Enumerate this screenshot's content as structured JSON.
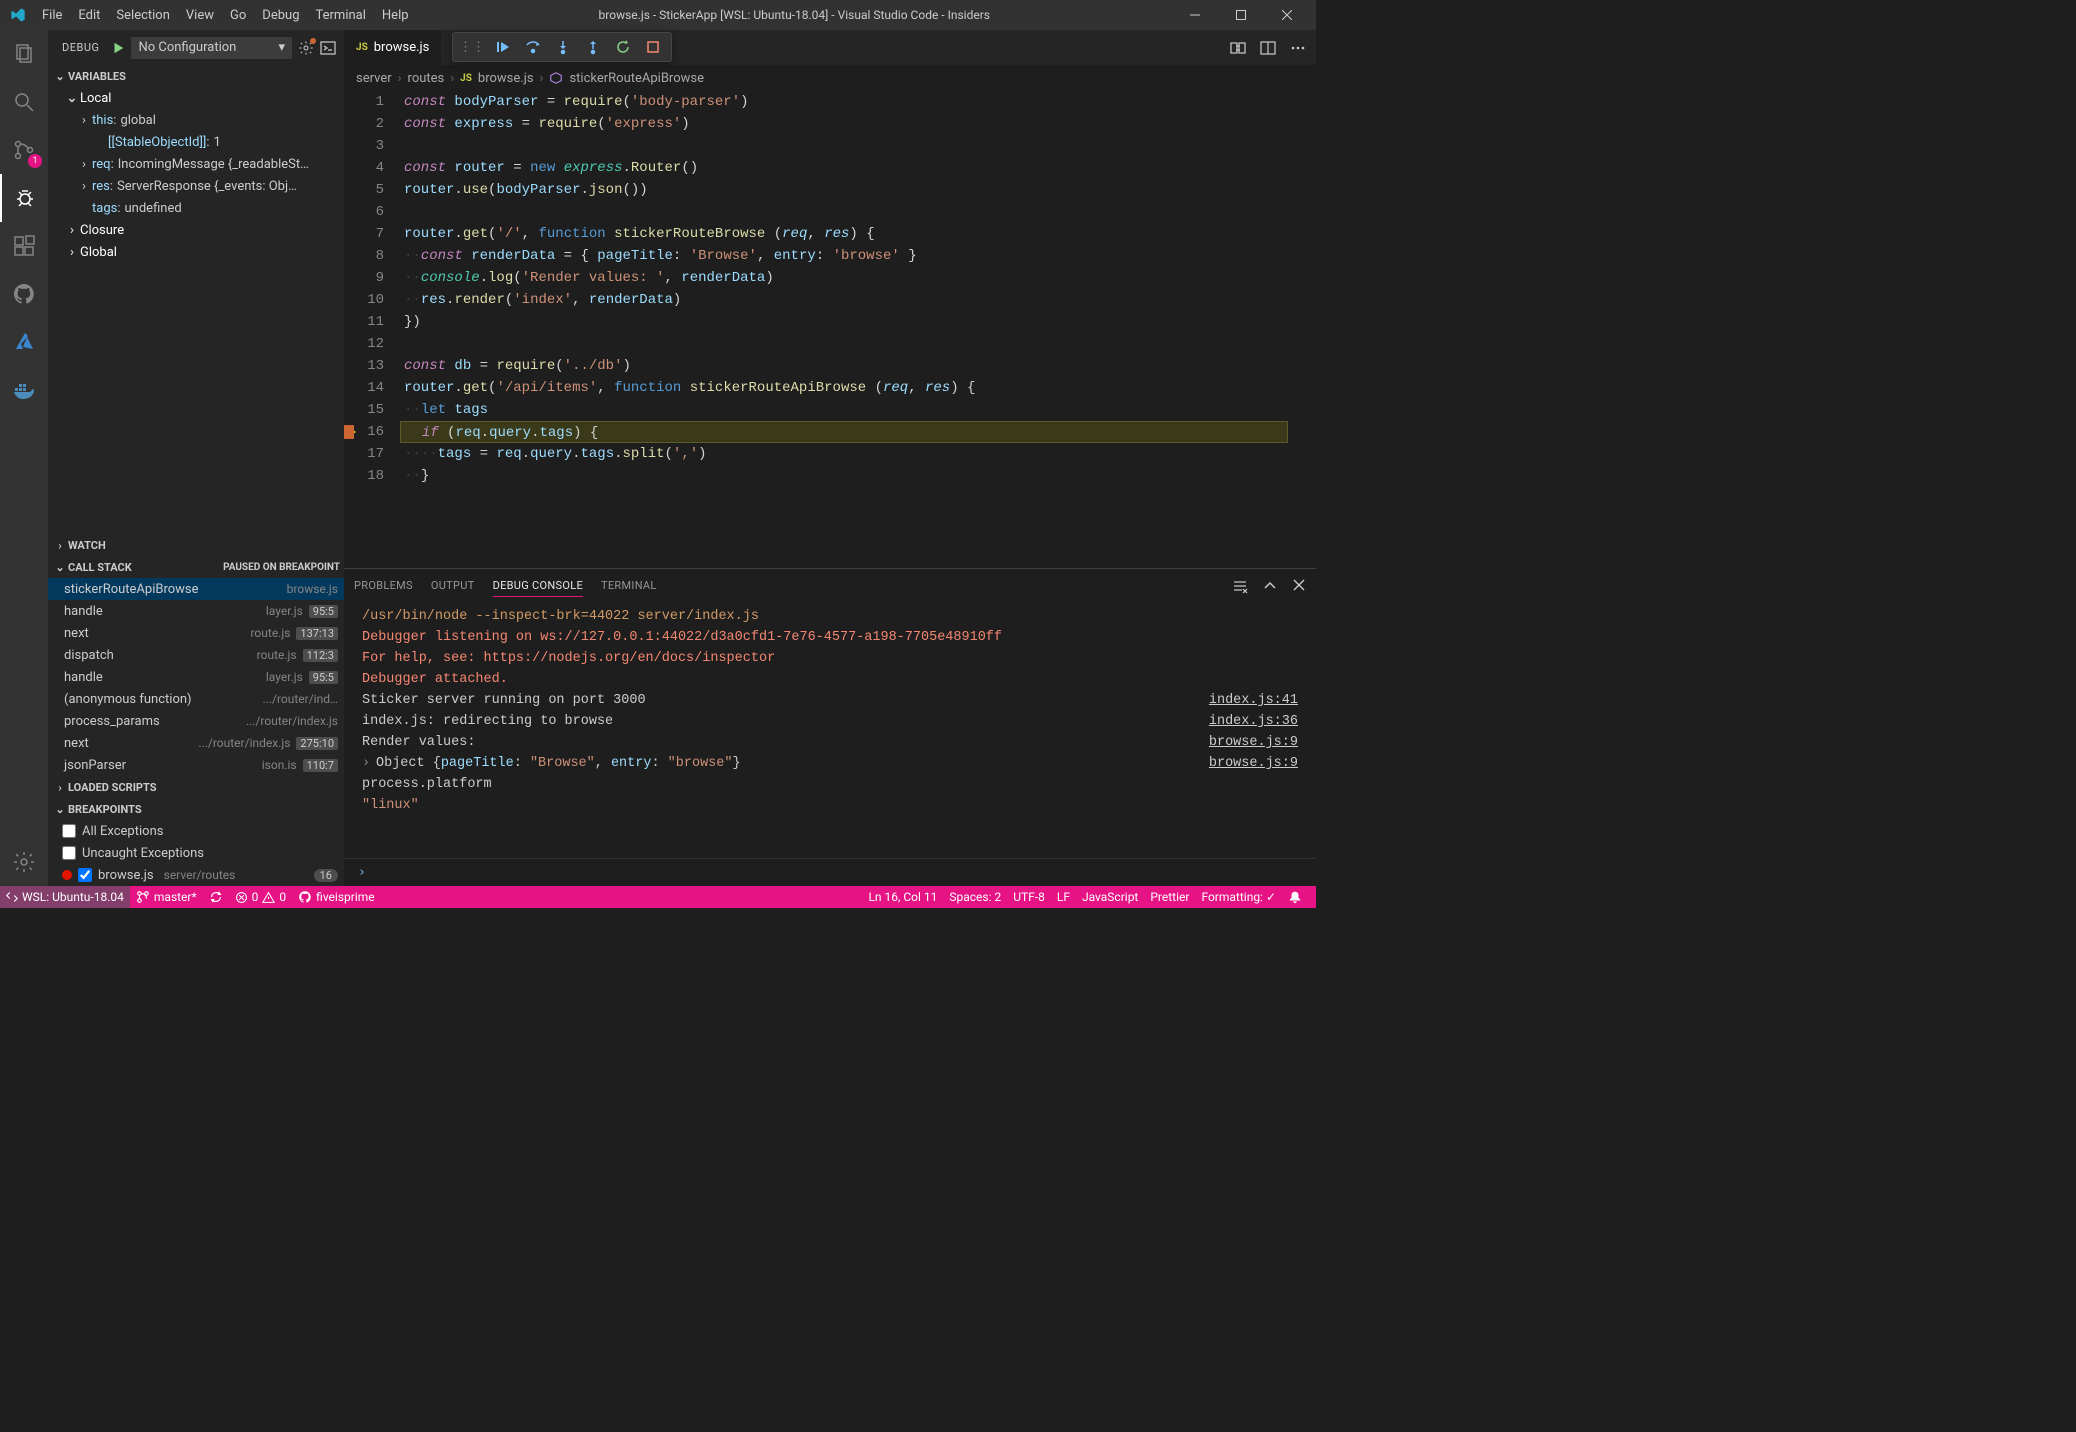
{
  "titlebar": {
    "menu": [
      "File",
      "Edit",
      "Selection",
      "View",
      "Go",
      "Debug",
      "Terminal",
      "Help"
    ],
    "title": "browse.js - StickerApp [WSL: Ubuntu-18.04] - Visual Studio Code - Insiders"
  },
  "activitybar": {
    "scm_badge": "1"
  },
  "debugHeader": {
    "title": "DEBUG",
    "config": "No Configuration"
  },
  "variables": {
    "header": "VARIABLES",
    "groups": {
      "local": "Local",
      "closure": "Closure",
      "global": "Global"
    },
    "local_vars": [
      {
        "name": "this",
        "value": "global",
        "expandable": true
      },
      {
        "name": "[[StableObjectId]]",
        "value": "1",
        "expandable": false
      },
      {
        "name": "req",
        "value": "IncomingMessage {_readableSt…",
        "expandable": true
      },
      {
        "name": "res",
        "value": "ServerResponse {_events: Obj…",
        "expandable": true
      },
      {
        "name": "tags",
        "value": "undefined",
        "expandable": false
      }
    ]
  },
  "watch": {
    "header": "WATCH"
  },
  "callstack": {
    "header": "CALL STACK",
    "status": "PAUSED ON BREAKPOINT",
    "frames": [
      {
        "fn": "stickerRouteApiBrowse",
        "src": "browse.js",
        "pos": ""
      },
      {
        "fn": "handle",
        "src": "layer.js",
        "pos": "95:5"
      },
      {
        "fn": "next",
        "src": "route.js",
        "pos": "137:13"
      },
      {
        "fn": "dispatch",
        "src": "route.js",
        "pos": "112:3"
      },
      {
        "fn": "handle",
        "src": "layer.js",
        "pos": "95:5"
      },
      {
        "fn": "(anonymous function)",
        "src": ".../router/ind…",
        "pos": ""
      },
      {
        "fn": "process_params",
        "src": ".../router/index.js",
        "pos": ""
      },
      {
        "fn": "next",
        "src": ".../router/index.js",
        "pos": "275:10"
      },
      {
        "fn": "jsonParser",
        "src": "ison.is",
        "pos": "110:7"
      }
    ]
  },
  "loadedScripts": {
    "header": "LOADED SCRIPTS"
  },
  "breakpoints": {
    "header": "BREAKPOINTS",
    "items": [
      {
        "type": "check",
        "checked": false,
        "label": "All Exceptions"
      },
      {
        "type": "check",
        "checked": false,
        "label": "Uncaught Exceptions"
      },
      {
        "type": "bp",
        "checked": true,
        "label": "browse.js",
        "path": "server/routes",
        "count": "16"
      }
    ]
  },
  "tab": {
    "name": "browse.js"
  },
  "breadcrumb": {
    "items": [
      "server",
      "routes",
      "browse.js",
      "stickerRouteApiBrowse"
    ]
  },
  "code": {
    "current_line": 16,
    "lines": [
      {
        "n": 1,
        "html": "<span class='kw'>const</span> <span class='var'>bodyParser</span> <span class='op'>=</span> <span class='fn'>require</span><span class='op'>(</span><span class='str'>'body-parser'</span><span class='op'>)</span>"
      },
      {
        "n": 2,
        "html": "<span class='kw'>const</span> <span class='var'>express</span> <span class='op'>=</span> <span class='fn'>require</span><span class='op'>(</span><span class='str'>'express'</span><span class='op'>)</span>"
      },
      {
        "n": 3,
        "html": ""
      },
      {
        "n": 4,
        "html": "<span class='kw'>const</span> <span class='var'>router</span> <span class='op'>=</span> <span class='kw2'>new</span> <span class='obj' style='font-style:italic'>express</span><span class='dot'>.</span><span class='fn'>Router</span><span class='op'>()</span>"
      },
      {
        "n": 5,
        "html": "<span class='var'>router</span><span class='dot'>.</span><span class='fn'>use</span><span class='op'>(</span><span class='var'>bodyParser</span><span class='dot'>.</span><span class='fn'>json</span><span class='op'>())</span>"
      },
      {
        "n": 6,
        "html": ""
      },
      {
        "n": 7,
        "html": "<span class='var'>router</span><span class='dot'>.</span><span class='fn'>get</span><span class='op'>(</span><span class='str'>'/'</span><span class='op'>,</span> <span class='kw2'>function</span> <span class='fn'>stickerRouteBrowse</span> <span class='op'>(</span><span class='param'>req</span><span class='op'>,</span> <span class='param'>res</span><span class='op'>) {</span>"
      },
      {
        "n": 8,
        "html": "<span class='ws'>··</span><span class='kw'>const</span> <span class='var'>renderData</span> <span class='op'>= {</span> <span class='prop'>pageTitle</span><span class='op'>:</span> <span class='str'>'Browse'</span><span class='op'>,</span> <span class='prop'>entry</span><span class='op'>:</span> <span class='str'>'browse'</span> <span class='op'>}</span>"
      },
      {
        "n": 9,
        "html": "<span class='ws'>··</span><span class='obj' style='font-style:italic'>console</span><span class='dot'>.</span><span class='fn'>log</span><span class='op'>(</span><span class='str'>'Render values: '</span><span class='op'>,</span> <span class='var'>renderData</span><span class='op'>)</span>"
      },
      {
        "n": 10,
        "html": "<span class='ws'>··</span><span class='var'>res</span><span class='dot'>.</span><span class='fn'>render</span><span class='op'>(</span><span class='str'>'index'</span><span class='op'>,</span> <span class='var'>renderData</span><span class='op'>)</span>"
      },
      {
        "n": 11,
        "html": "<span class='op'>})</span>"
      },
      {
        "n": 12,
        "html": ""
      },
      {
        "n": 13,
        "html": "<span class='kw'>const</span> <span class='var'>db</span> <span class='op'>=</span> <span class='fn'>require</span><span class='op'>(</span><span class='str'>'../db'</span><span class='op'>)</span>"
      },
      {
        "n": 14,
        "html": "<span class='var'>router</span><span class='dot'>.</span><span class='fn'>get</span><span class='op'>(</span><span class='str'>'/api/items'</span><span class='op'>,</span> <span class='kw2'>function</span> <span class='fn'>stickerRouteApiBrowse</span> <span class='op'>(</span><span class='param'>req</span><span class='op'>,</span> <span class='param'>res</span><span class='op'>) {</span>"
      },
      {
        "n": 15,
        "html": "<span class='ws'>··</span><span class='kw2'>let</span> <span class='var'>tags</span>"
      },
      {
        "n": 16,
        "html": "<span class='ws'>··</span><span class='kw'>if</span> <span class='op'>(</span><span class='var'>req</span><span class='dot'>.</span><span class='prop'>query</span><span class='dot'>.</span><span class='prop'>tags</span><span class='op'>) {</span>"
      },
      {
        "n": 17,
        "html": "<span class='ws'>····</span><span class='var'>tags</span> <span class='op'>=</span> <span class='var'>req</span><span class='dot'>.</span><span class='prop'>query</span><span class='dot'>.</span><span class='prop'>tags</span><span class='dot'>.</span><span class='fn'>split</span><span class='op'>(</span><span class='str'>','</span><span class='op'>)</span>"
      },
      {
        "n": 18,
        "html": "<span class='ws'>··</span><span class='op'>}</span>"
      }
    ]
  },
  "panel": {
    "tabs": [
      "PROBLEMS",
      "OUTPUT",
      "DEBUG CONSOLE",
      "TERMINAL"
    ],
    "active": 2,
    "lines": [
      {
        "cls": "warn",
        "txt": "/usr/bin/node --inspect-brk=44022 server/index.js",
        "src": ""
      },
      {
        "cls": "info",
        "txt": "Debugger listening on ws://127.0.0.1:44022/d3a0cfd1-7e76-4577-a198-7705e48910ff",
        "src": ""
      },
      {
        "cls": "info",
        "txt": "For help, see: https://nodejs.org/en/docs/inspector",
        "src": ""
      },
      {
        "cls": "info",
        "txt": "Debugger attached.",
        "src": ""
      },
      {
        "cls": "plain",
        "txt": "Sticker server running on port 3000",
        "src": "index.js:41"
      },
      {
        "cls": "plain",
        "txt": "index.js: redirecting to browse",
        "src": "index.js:36"
      },
      {
        "cls": "plain",
        "txt": "Render values: ",
        "src": "browse.js:9"
      },
      {
        "cls": "objline",
        "txt": "Object {pageTitle: \"Browse\", entry: \"browse\"}",
        "src": "browse.js:9",
        "chev": true
      },
      {
        "cls": "plain",
        "txt": "process.platform",
        "src": ""
      },
      {
        "cls": "strval",
        "txt": "\"linux\"",
        "src": ""
      }
    ]
  },
  "statusbar": {
    "wsl": "WSL: Ubuntu-18.04",
    "branch": "master*",
    "errors": "0",
    "warnings": "0",
    "gh": "fiveisprime",
    "pos": "Ln 16, Col 11",
    "spaces": "Spaces: 2",
    "enc": "UTF-8",
    "eol": "LF",
    "lang": "JavaScript",
    "prettier": "Prettier",
    "formatting": "Formatting: ✓"
  }
}
